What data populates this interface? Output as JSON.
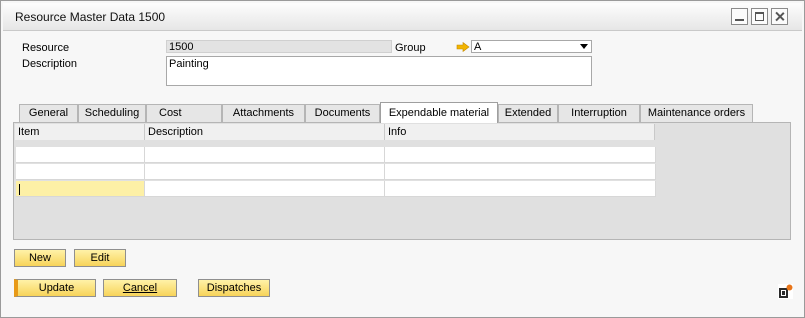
{
  "window": {
    "title": "Resource Master Data 1500"
  },
  "header": {
    "resource_label": "Resource",
    "resource_value": "1500",
    "group_label": "Group",
    "group_value": "A",
    "description_label": "Description",
    "description_value": "Painting"
  },
  "tabs": [
    {
      "label": "General"
    },
    {
      "label": "Scheduling"
    },
    {
      "label": "Cost"
    },
    {
      "label": "Attachments"
    },
    {
      "label": "Documents"
    },
    {
      "label": "Expendable material"
    },
    {
      "label": "Extended"
    },
    {
      "label": "Interruption"
    },
    {
      "label": "Maintenance orders"
    }
  ],
  "active_tab": "Expendable material",
  "grid": {
    "columns": [
      "Item",
      "Description",
      "Info"
    ],
    "rows": [
      [
        "",
        "",
        ""
      ],
      [
        "",
        "",
        ""
      ],
      [
        "",
        "",
        ""
      ]
    ]
  },
  "buttons": {
    "new": "New",
    "edit": "Edit",
    "update": "Update",
    "cancel": "Cancel",
    "dispatches": "Dispatches"
  },
  "colors": {
    "button_fill": "#f7d35a",
    "selected_cell": "#fdf0a6",
    "link_arrow": "#f2b400",
    "logo": "#e8751a"
  }
}
